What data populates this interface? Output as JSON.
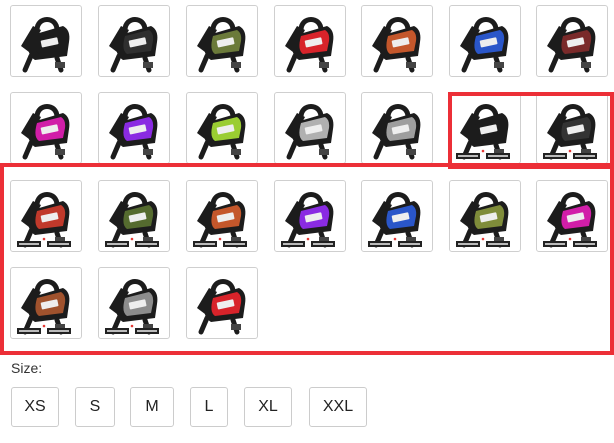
{
  "colors": {
    "highlight": "#ec2f37",
    "harness_base": "#1c1c1c",
    "swatch_border": "#cfcfcf"
  },
  "color_options": {
    "rows": [
      [
        {
          "icon": "harness-icon",
          "accent": "#1c1c1c",
          "tags": false
        },
        {
          "icon": "harness-icon",
          "accent": "#2f2f2f",
          "tags": false
        },
        {
          "icon": "harness-icon",
          "accent": "#6b7a3a",
          "tags": false
        },
        {
          "icon": "harness-icon",
          "accent": "#d8232a",
          "tags": false
        },
        {
          "icon": "harness-icon",
          "accent": "#c4572b",
          "tags": false
        },
        {
          "icon": "harness-icon",
          "accent": "#2a56c9",
          "tags": false
        },
        {
          "icon": "harness-icon",
          "accent": "#7a2a2a",
          "tags": false
        }
      ],
      [
        {
          "icon": "harness-icon",
          "accent": "#d11ea8",
          "tags": false
        },
        {
          "icon": "harness-icon",
          "accent": "#8a2be2",
          "tags": false
        },
        {
          "icon": "harness-icon",
          "accent": "#9acd32",
          "tags": false
        },
        {
          "icon": "harness-icon",
          "accent": "#b0b0b0",
          "tags": false
        },
        {
          "icon": "harness-icon",
          "accent": "#9e9e9e",
          "tags": false
        },
        {
          "icon": "harness-icon",
          "accent": "#1c1c1c",
          "tags": true
        },
        {
          "icon": "harness-icon",
          "accent": "#333333",
          "tags": true
        }
      ],
      [
        {
          "icon": "harness-icon",
          "accent": "#c0392b",
          "tags": true
        },
        {
          "icon": "harness-icon",
          "accent": "#556b2f",
          "tags": true
        },
        {
          "icon": "harness-icon",
          "accent": "#c4572b",
          "tags": true
        },
        {
          "icon": "harness-icon",
          "accent": "#8a2be2",
          "tags": true
        },
        {
          "icon": "harness-icon",
          "accent": "#2a56c9",
          "tags": true
        },
        {
          "icon": "harness-icon",
          "accent": "#7f8c3a",
          "tags": true
        },
        {
          "icon": "harness-icon",
          "accent": "#d11ea8",
          "tags": true
        }
      ],
      [
        {
          "icon": "harness-icon",
          "accent": "#a0522d",
          "tags": true
        },
        {
          "icon": "harness-icon",
          "accent": "#8c8c8c",
          "tags": true
        },
        {
          "icon": "harness-icon",
          "accent": "#d8232a",
          "tags": false
        }
      ]
    ]
  },
  "size": {
    "label": "Size:",
    "options": [
      "XS",
      "S",
      "M",
      "L",
      "XL",
      "XXL"
    ]
  }
}
